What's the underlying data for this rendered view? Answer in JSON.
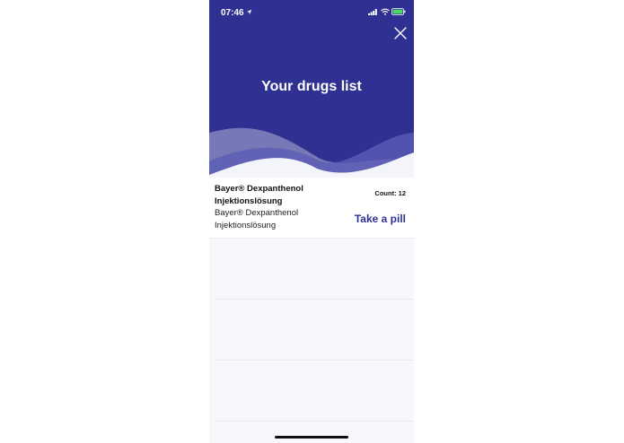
{
  "status_bar": {
    "time": "07:46"
  },
  "header": {
    "title": "Your drugs list",
    "background_color": "#2e3192"
  },
  "drugs": [
    {
      "name": "Bayer® Dexpanthenol Injektionslösung",
      "description": "Bayer® Dexpanthenol Injektionslösung",
      "count_label": "Count: 12",
      "action_label": "Take a pill"
    }
  ],
  "icons": {
    "close": "close-icon",
    "location": "location-arrow-icon",
    "signal": "signal-icon",
    "wifi": "wifi-icon",
    "battery": "battery-icon"
  },
  "colors": {
    "accent": "#2e3192",
    "list_background": "#f8f8fc"
  }
}
